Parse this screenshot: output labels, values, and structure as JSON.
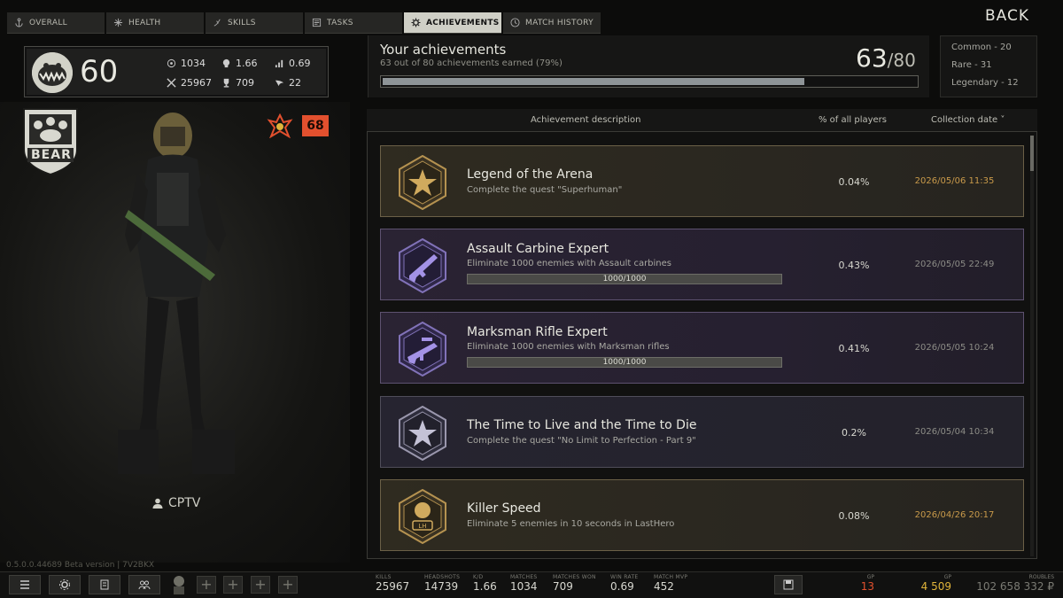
{
  "tabs": [
    {
      "label": "OVERALL",
      "icon": "anchor-icon"
    },
    {
      "label": "HEALTH",
      "icon": "health-icon"
    },
    {
      "label": "SKILLS",
      "icon": "skills-icon"
    },
    {
      "label": "TASKS",
      "icon": "tasks-icon"
    },
    {
      "label": "ACHIEVEMENTS",
      "icon": "gear-icon"
    },
    {
      "label": "MATCH HISTORY",
      "icon": "clock-icon"
    }
  ],
  "back_label": "BACK",
  "profile": {
    "level": "60",
    "stats": {
      "matches": "1034",
      "kd": "1.66",
      "winrate": "0.69",
      "kills": "25967",
      "wins": "709",
      "mvp": "22"
    },
    "faction": "BEAR",
    "prestige_badge": "68",
    "username": "CPTV"
  },
  "version_text": "0.5.0.0.44689 Beta version | 7V2BKX",
  "summary": {
    "title": "Your achievements",
    "subtitle": "63 out of 80 achievements earned (79%)",
    "earned": "63",
    "total": "/80",
    "progress": 0.79
  },
  "rarities": [
    "Common - 20",
    "Rare - 31",
    "Legendary - 12"
  ],
  "list_header": {
    "description": "Achievement description",
    "percent": "% of all players",
    "date": "Collection date ˅"
  },
  "achievements": [
    {
      "title": "Legend of the Arena",
      "desc": "Complete the quest \"Superhuman\"",
      "progress_text": "",
      "progress": null,
      "percent": "0.04%",
      "date": "2026/05/06 11:35",
      "rarity": "gold",
      "icon": "star-icon"
    },
    {
      "title": "Assault Carbine Expert",
      "desc": "Eliminate 1000 enemies with Assault carbines",
      "progress_text": "1000/1000",
      "progress": 1,
      "percent": "0.43%",
      "date": "2026/05/05 22:49",
      "rarity": "purple",
      "icon": "carbine-icon"
    },
    {
      "title": "Marksman Rifle Expert",
      "desc": "Eliminate 1000 enemies with Marksman rifles",
      "progress_text": "1000/1000",
      "progress": 1,
      "percent": "0.41%",
      "date": "2026/05/05 10:24",
      "rarity": "purple",
      "icon": "rifle-icon"
    },
    {
      "title": "The Time to Live and the Time to Die",
      "desc": "Complete the quest \"No Limit to Perfection - Part 9\"",
      "progress_text": "",
      "progress": null,
      "percent": "0.2%",
      "date": "2026/05/04 10:34",
      "rarity": "plain",
      "icon": "star-icon"
    },
    {
      "title": "Killer Speed",
      "desc": "Eliminate 5 enemies in 10 seconds in LastHero",
      "progress_text": "",
      "progress": null,
      "percent": "0.08%",
      "date": "2026/04/26 20:17",
      "rarity": "gold",
      "icon": "lasthero-icon"
    }
  ],
  "bottom_stats": [
    {
      "label": "KILLS",
      "value": "25967"
    },
    {
      "label": "HEADSHOTS",
      "value": "14739"
    },
    {
      "label": "K/D",
      "value": "1.66"
    },
    {
      "label": "MATCHES",
      "value": "1034"
    },
    {
      "label": "MATCHES WON",
      "value": "709"
    },
    {
      "label": "WIN RATE",
      "value": "0.69"
    },
    {
      "label": "MATCH MVP",
      "value": "452"
    }
  ],
  "currencies": [
    {
      "label": "GP",
      "value": "13",
      "color": "#e2502e"
    },
    {
      "label": "GP",
      "value": "4 509",
      "color": "#e0b43a"
    },
    {
      "label": "ROUBLES",
      "value": "102 658 332 ₽",
      "color": "#d8d8d0"
    }
  ],
  "colors": {
    "gold": "#c99a4a",
    "purple": "#8a78c8",
    "accent": "#e2502e"
  }
}
